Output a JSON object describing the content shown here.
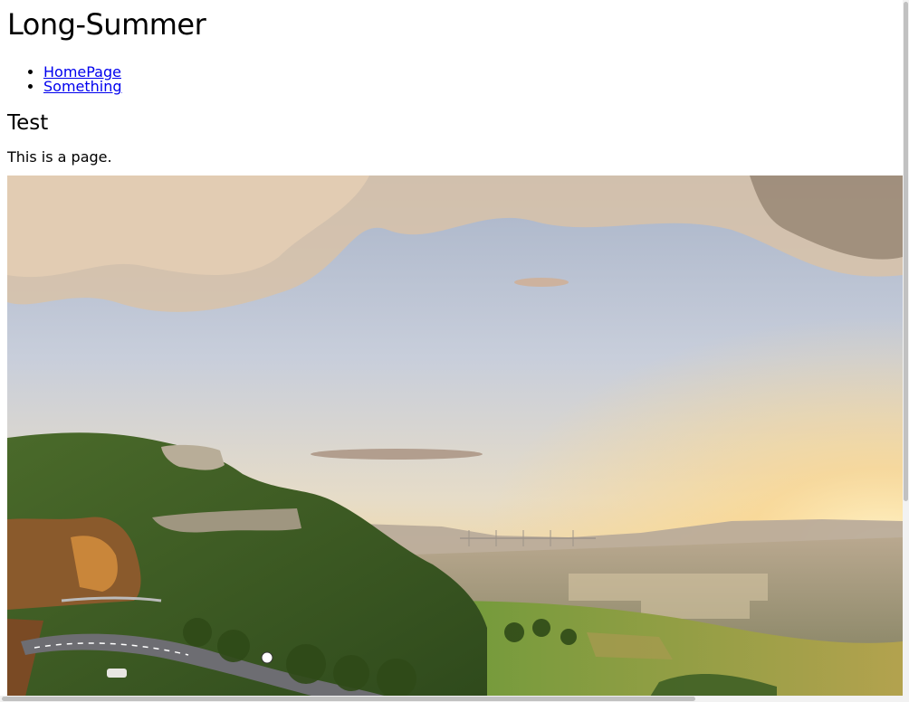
{
  "header": {
    "site_title": "Long-Summer"
  },
  "nav": {
    "items": [
      {
        "label": "HomePage"
      },
      {
        "label": "Something"
      }
    ]
  },
  "content": {
    "heading": "Test",
    "paragraph": "This is a page.",
    "image": {
      "subject": "sunset over green valley with cliffs, winding mountain road and town"
    }
  },
  "colors": {
    "link": "#0000ee",
    "text": "#000000",
    "background": "#ffffff"
  }
}
